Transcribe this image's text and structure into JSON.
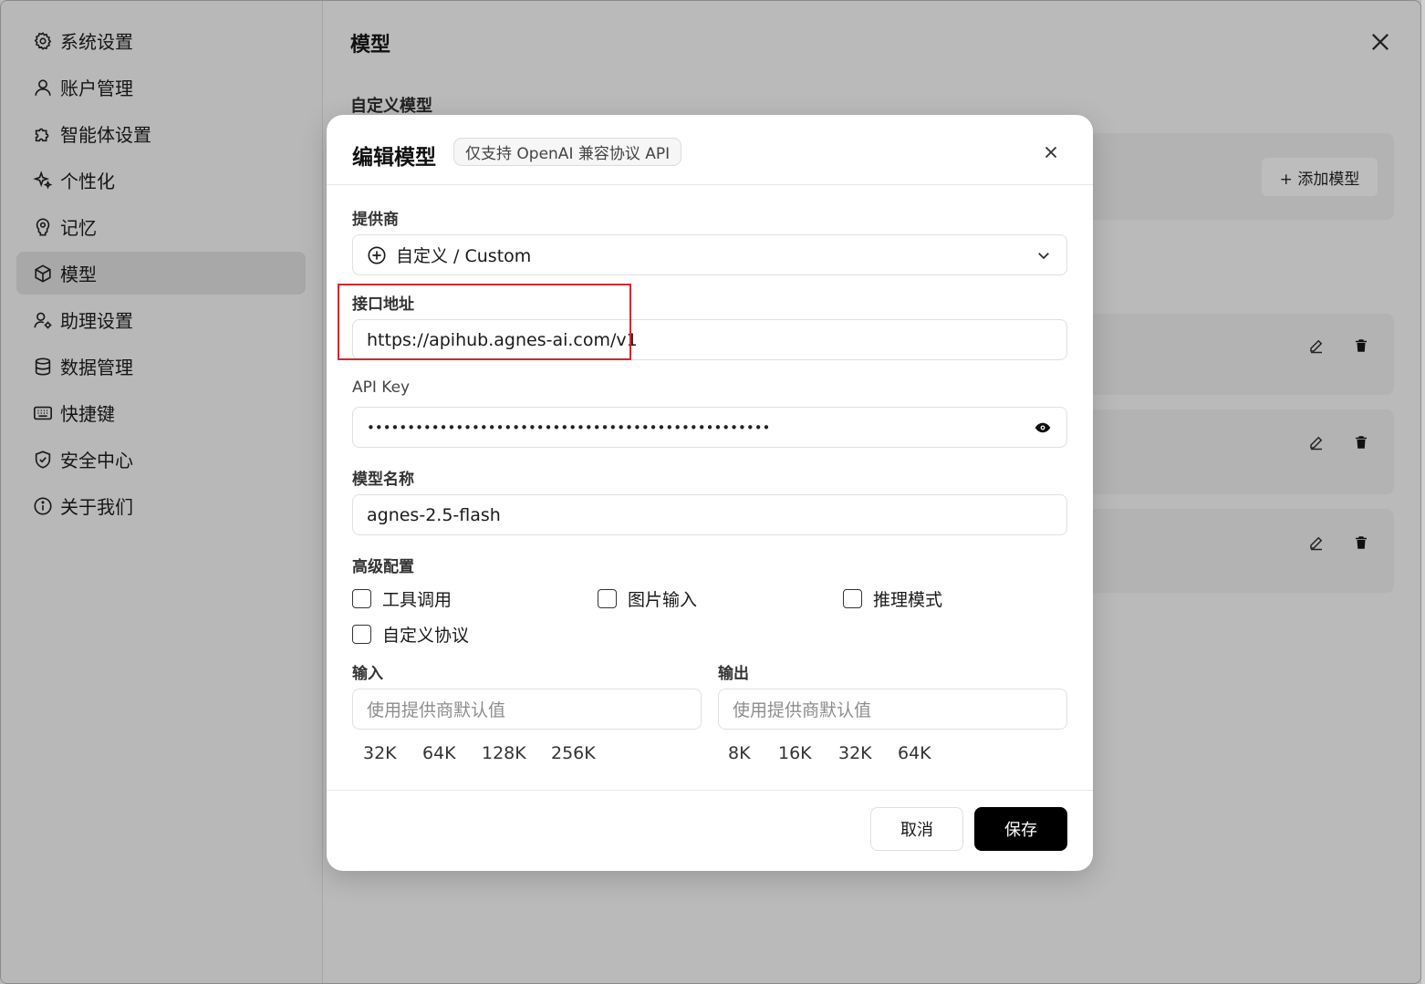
{
  "sidebar": {
    "items": [
      {
        "label": "系统设置",
        "icon": "gear-icon"
      },
      {
        "label": "账户管理",
        "icon": "user-icon"
      },
      {
        "label": "智能体设置",
        "icon": "puzzle-icon"
      },
      {
        "label": "个性化",
        "icon": "sparkles-icon"
      },
      {
        "label": "记忆",
        "icon": "brain-icon"
      },
      {
        "label": "模型",
        "icon": "cube-icon",
        "active": true
      },
      {
        "label": "助理设置",
        "icon": "user-gear-icon"
      },
      {
        "label": "数据管理",
        "icon": "database-icon"
      },
      {
        "label": "快捷键",
        "icon": "keyboard-icon"
      },
      {
        "label": "安全中心",
        "icon": "shield-check-icon"
      },
      {
        "label": "关于我们",
        "icon": "info-icon"
      }
    ]
  },
  "main": {
    "title": "模型",
    "section_title": "自定义模型",
    "add_model_label": "+ 添加模型"
  },
  "modal": {
    "title": "编辑模型",
    "badge": "仅支持 OpenAI 兼容协议 API",
    "provider": {
      "label": "提供商",
      "value": "自定义 / Custom"
    },
    "endpoint": {
      "label": "接口地址",
      "value": "https://apihub.agnes-ai.com/v1"
    },
    "api_key": {
      "label": "API Key",
      "masked_value": "••••••••••••••••••••••••••••••••••••••••••••••••••"
    },
    "model_name": {
      "label": "模型名称",
      "value": "agnes-2.5-flash"
    },
    "advanced": {
      "label": "高级配置",
      "options": [
        {
          "label": "工具调用",
          "checked": false
        },
        {
          "label": "图片输入",
          "checked": false
        },
        {
          "label": "推理模式",
          "checked": false
        },
        {
          "label": "自定义协议",
          "checked": false
        }
      ]
    },
    "input": {
      "label": "输入",
      "placeholder": "使用提供商默认值",
      "presets": [
        "32K",
        "64K",
        "128K",
        "256K"
      ]
    },
    "output": {
      "label": "输出",
      "placeholder": "使用提供商默认值",
      "presets": [
        "8K",
        "16K",
        "32K",
        "64K"
      ]
    },
    "cancel_label": "取消",
    "save_label": "保存"
  },
  "colors": {
    "highlight_border": "#d9262e",
    "primary_button": "#000000"
  }
}
